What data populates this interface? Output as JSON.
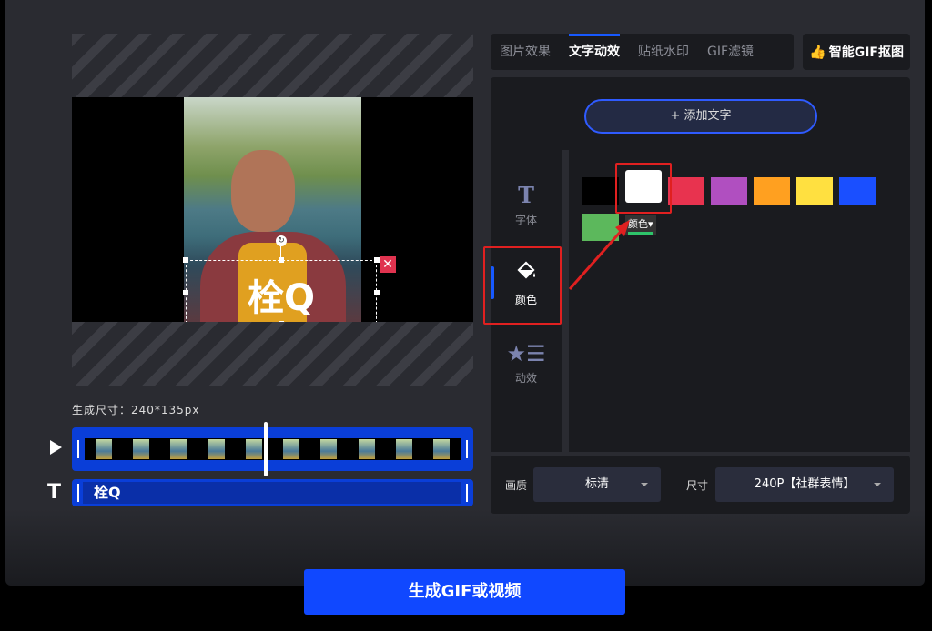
{
  "preview": {
    "overlay_text": "栓Q",
    "rotate_glyph": "↻",
    "close_glyph": "✕",
    "gen_size_label": "生成尺寸：240*135px"
  },
  "timeline": {
    "text_track_label": "栓Q",
    "frame_count": 10
  },
  "tabs": [
    {
      "label": "图片效果",
      "active": false
    },
    {
      "label": "文字动效",
      "active": true
    },
    {
      "label": "贴纸水印",
      "active": false
    },
    {
      "label": "GIF滤镜",
      "active": false
    }
  ],
  "smart_button": {
    "label": "智能GIF抠图",
    "icon": "thumbs-up-icon"
  },
  "add_text_button": "+ 添加文字",
  "side_nav": [
    {
      "label": "字体",
      "icon": "font-t-icon",
      "glyph": "T"
    },
    {
      "label": "颜色",
      "icon": "paint-bucket-icon",
      "glyph": "🪣"
    },
    {
      "label": "动效",
      "icon": "star-list-icon",
      "glyph": "★☰"
    }
  ],
  "colors": {
    "swatches": [
      "#000000",
      "#ffffff",
      "#e8334f",
      "#b04fc0",
      "#ffa020",
      "#ffe040",
      "#1a4fff",
      "#5cb85c"
    ],
    "selected": "#ffffff",
    "dropdown_label": "颜色"
  },
  "settings": {
    "quality_label": "画质",
    "quality_value": "标清",
    "size_label": "尺寸",
    "size_value": "240P【社群表情】"
  },
  "generate_button": "生成GIF或视频",
  "accent": "#1759ff",
  "highlight_red": "#e02020"
}
